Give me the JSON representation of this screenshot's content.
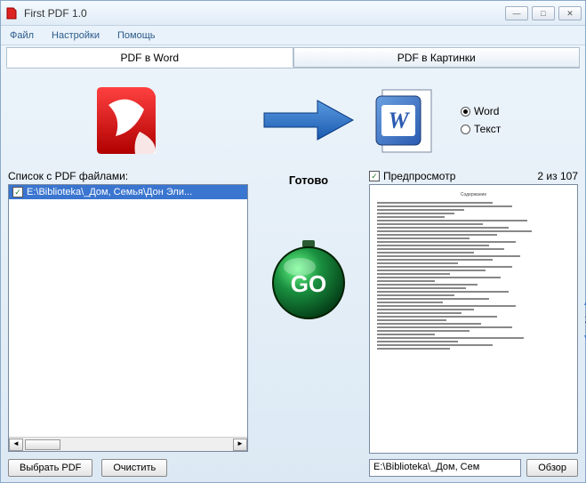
{
  "window": {
    "title": "First PDF 1.0"
  },
  "menubar": {
    "file": "Файл",
    "settings": "Настройки",
    "help": "Помощь"
  },
  "tabs": {
    "pdf_to_word": "PDF в Word",
    "pdf_to_images": "PDF в Картинки"
  },
  "formats": {
    "word": "Word",
    "text": "Текст"
  },
  "left": {
    "list_label": "Список c PDF файлами:",
    "file_item": "E:\\Biblioteka\\_Дом, Семья\\Дон Эли...",
    "select_pdf_btn": "Выбрать PDF",
    "clear_btn": "Очистить"
  },
  "status": "Готово",
  "go_label": "GO",
  "preview": {
    "checkbox_label": "Предпросмотр",
    "page_counter": "2 из 107",
    "current_page": "2"
  },
  "output": {
    "path": "E:\\Biblioteka\\_Дом, Сем",
    "browse_btn": "Обзор"
  }
}
